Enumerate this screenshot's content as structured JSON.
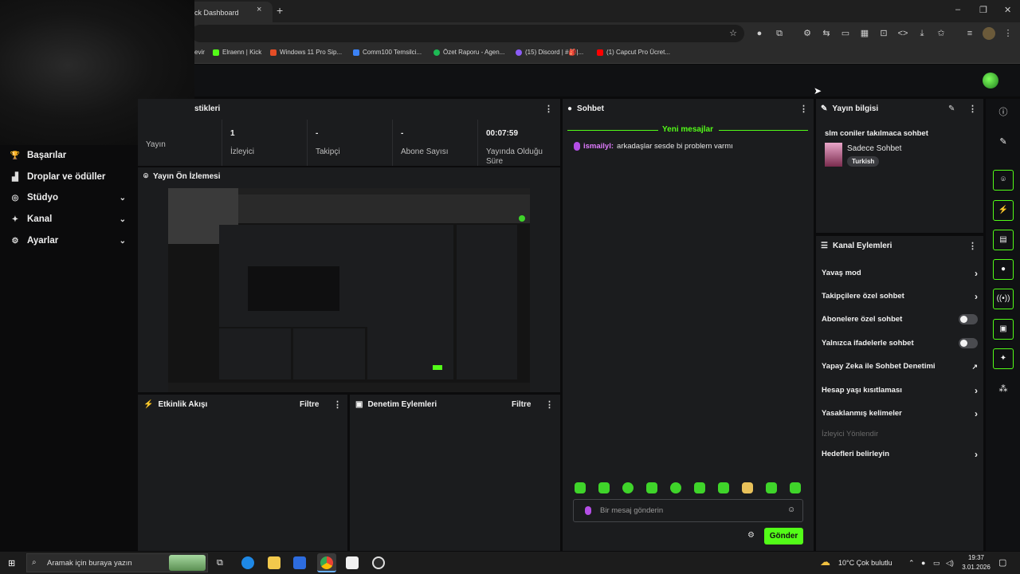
{
  "browser": {
    "tab_title": "ick Dashboard",
    "tab_close": "×",
    "new_tab": "+",
    "win_min": "–",
    "win_max": "❐",
    "win_close": "✕",
    "bookmarks": [
      {
        "label": "evir",
        "color": "#888888"
      },
      {
        "label": "Elraenn | Kick",
        "color": "#53fc18"
      },
      {
        "label": "Windows 11 Pro Sip...",
        "color": "#e44d26"
      },
      {
        "label": "Comm100 Temsilci...",
        "color": "#3b82f6"
      },
      {
        "label": "Özet Raporu - Agen...",
        "color": "#1db954"
      },
      {
        "label": "(15) Discord | #🎒|...",
        "color": "#8b5cf6"
      },
      {
        "label": "(1) Capcut Pro Ücret...",
        "color": "#ff0000"
      }
    ]
  },
  "sidebar": {
    "items": [
      {
        "label": "Başarılar",
        "icon": "trophy-icon",
        "glyph": "🏆",
        "chev": ""
      },
      {
        "label": "Droplar ve ödüller",
        "icon": "drops-icon",
        "glyph": "▟",
        "chev": ""
      },
      {
        "label": "Stüdyo",
        "icon": "studio-icon",
        "glyph": "◎",
        "chev": "⌄"
      },
      {
        "label": "Kanal",
        "icon": "channel-icon",
        "glyph": "✦",
        "chev": "⌄"
      },
      {
        "label": "Ayarlar",
        "icon": "settings-icon",
        "glyph": "⚙",
        "chev": "⌄"
      }
    ]
  },
  "stats": {
    "title": "stikleri",
    "items": [
      {
        "value": "",
        "label": "Yayın"
      },
      {
        "value": "1",
        "label": "İzleyici"
      },
      {
        "value": "-",
        "label": "Takipçi"
      },
      {
        "value": "-",
        "label": "Abone Sayısı"
      },
      {
        "value": "00:07:59",
        "label": "Yayında Olduğu Süre"
      }
    ]
  },
  "preview": {
    "title": "Yayın Ön İzlemesi"
  },
  "activity": {
    "title": "Etkinlik Akışı",
    "filter": "Filtre"
  },
  "moderation": {
    "title": "Denetim Eylemleri",
    "filter": "Filtre"
  },
  "chat": {
    "title": "Sohbet",
    "new_messages": "Yeni mesajlar",
    "message": {
      "user": "ismailyl:",
      "text": "arkadaşlar sesde bi problem varmı"
    },
    "input_placeholder": "Bir mesaj gönderin",
    "send_label": "Gönder",
    "accent": "#53fc18"
  },
  "stream_info": {
    "title": "Yayın bilgisi",
    "stream_title": "slm coniler takılmaca sohbet",
    "category": "Sadece Sohbet",
    "tag": "Turkish"
  },
  "channel_actions": {
    "title": "Kanal Eylemleri",
    "items": [
      {
        "label": "Yavaş mod",
        "control": "arrow"
      },
      {
        "label": "Takipçilere özel sohbet",
        "control": "arrow"
      },
      {
        "label": "Abonelere özel sohbet",
        "control": "toggle"
      },
      {
        "label": "Yalnızca ifadelerle sohbet",
        "control": "toggle"
      },
      {
        "label": "Yapay Zeka ile Sohbet Denetimi",
        "control": "external"
      },
      {
        "label": "Hesap yaşı kısıtlaması",
        "control": "arrow"
      },
      {
        "label": "Yasaklanmış kelimeler",
        "control": "arrow"
      },
      {
        "label": "İzleyici Yönlendir",
        "control": "disabled"
      },
      {
        "label": "Hedefleri belirleyin",
        "control": "arrow"
      }
    ]
  },
  "taskbar": {
    "search_placeholder": "Aramak için buraya yazın",
    "weather": "10°C  Çok bulutlu",
    "time": "19:37",
    "date": "3.01.2026"
  }
}
